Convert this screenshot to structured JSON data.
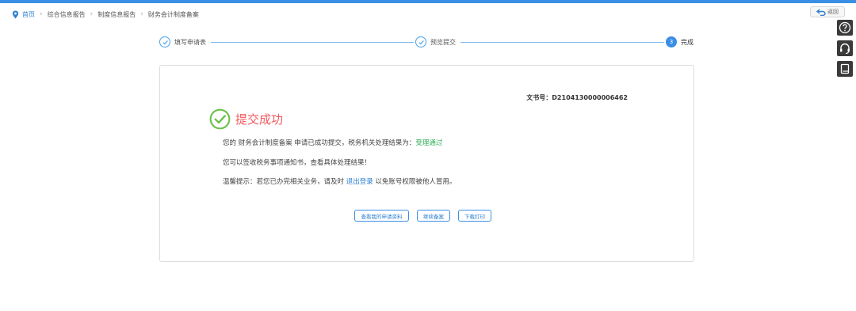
{
  "breadcrumb": {
    "home": "首页",
    "items": [
      "综合信息报告",
      "制度信息报告",
      "财务会计制度备案"
    ]
  },
  "back_label": "返回",
  "steps": [
    {
      "label": "填写申请表",
      "state": "done"
    },
    {
      "label": "预览提交",
      "state": "done"
    },
    {
      "label": "完成",
      "state": "active",
      "number": "3"
    }
  ],
  "result": {
    "doc_no": "文书号：D2104130000006462",
    "title": "提交成功",
    "line1_prefix": "您的 财务会计制度备案 申请已成功提交，税务机关处理结果为：",
    "line1_status": "受理通过",
    "line2": "您可以签收税务事项通知书，查看具体处理结果！",
    "line3_prefix": "温馨提示：若您已办完相关业务，请及时 ",
    "line3_link": "退出登录",
    "line3_suffix": " 以免账号权限被他人冒用。"
  },
  "buttons": {
    "view": "查看我的申请资料",
    "continue": "继续备案",
    "download": "下载打印"
  },
  "icons": [
    "location-pin-icon",
    "return-arrow-icon",
    "help-icon",
    "headset-icon",
    "book-icon",
    "check-circle-icon"
  ],
  "colors": {
    "accent": "#3a8ee6",
    "success_green": "#6cc04a",
    "success_text": "#f0585e",
    "status_green": "#2fae55"
  }
}
